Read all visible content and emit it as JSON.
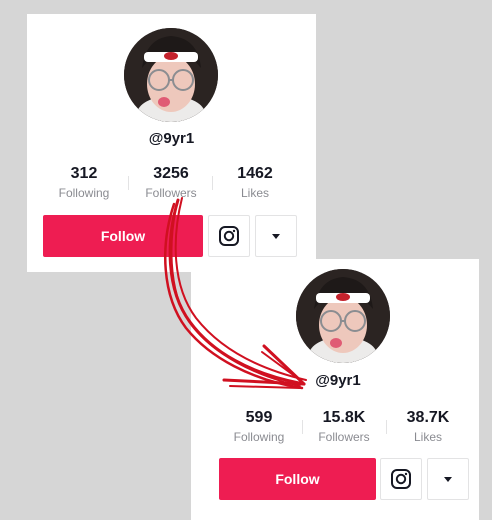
{
  "before": {
    "username": "@9yr1",
    "stats": [
      {
        "value": "312",
        "label": "Following"
      },
      {
        "value": "3256",
        "label": "Followers"
      },
      {
        "value": "1462",
        "label": "Likes"
      }
    ],
    "follow_label": "Follow"
  },
  "after": {
    "username": "@9yr1",
    "stats": [
      {
        "value": "599",
        "label": "Following"
      },
      {
        "value": "15.8K",
        "label": "Followers"
      },
      {
        "value": "38.7K",
        "label": "Likes"
      }
    ],
    "follow_label": "Follow"
  },
  "icons": {
    "instagram": "instagram-icon",
    "more": "chevron-down-icon",
    "arrow": "curved-arrow"
  },
  "colors": {
    "background": "#d6d6d6",
    "accent": "#ee1d52",
    "arrow": "#d01020",
    "text": "#161823",
    "muted": "#8a8b91"
  }
}
